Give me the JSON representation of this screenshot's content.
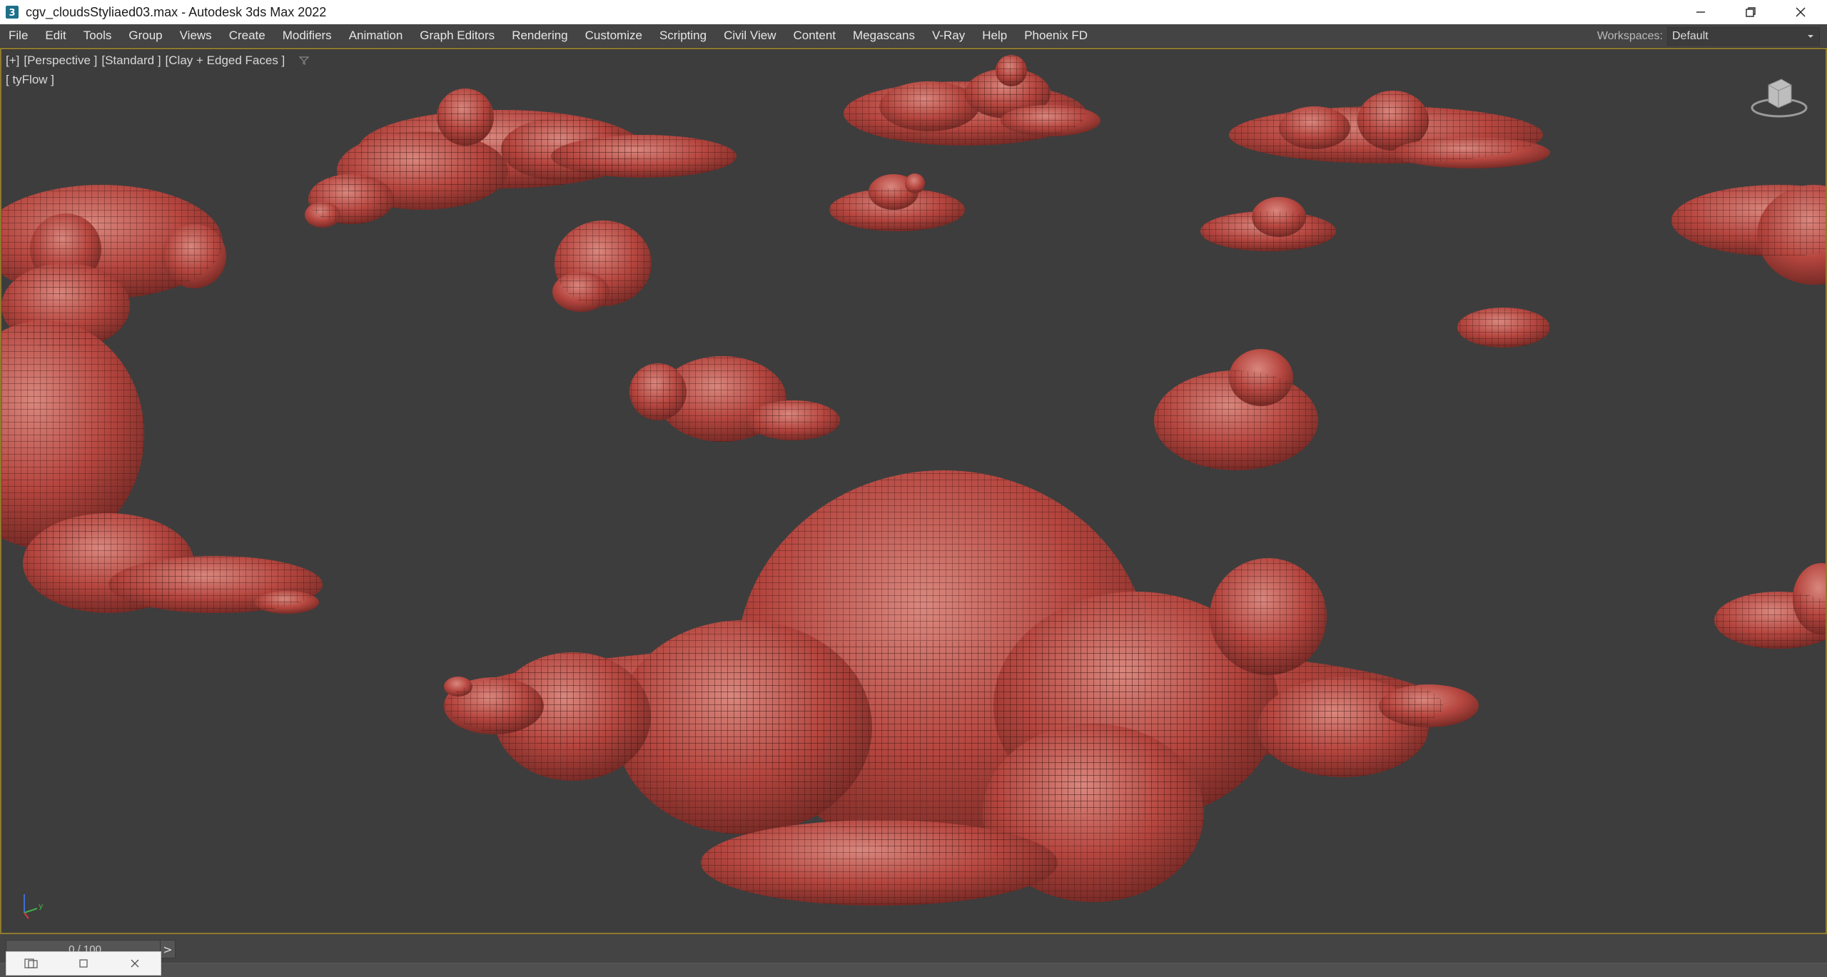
{
  "window": {
    "title": "cgv_cloudsStyliaed03.max - Autodesk 3ds Max 2022",
    "controls": [
      "minimize",
      "restore",
      "close"
    ]
  },
  "menubar": {
    "items": [
      "File",
      "Edit",
      "Tools",
      "Group",
      "Views",
      "Create",
      "Modifiers",
      "Animation",
      "Graph Editors",
      "Rendering",
      "Customize",
      "Scripting",
      "Civil View",
      "Content",
      "Megascans",
      "V-Ray",
      "Help",
      "Phoenix FD"
    ]
  },
  "workspaces": {
    "label": "Workspaces:",
    "value": "Default"
  },
  "viewport": {
    "label_plus": "[+]",
    "label_view": "[Perspective ]",
    "label_mode": "[Standard ]",
    "label_shading": "[Clay + Edged Faces ]",
    "label_plugin": "[ tyFlow ]",
    "mesh_color": "#b5463f",
    "background": "#3d3d3d",
    "axis": {
      "y": "y"
    }
  },
  "timeline": {
    "frame": "0 / 100",
    "next": ">"
  },
  "accent": "#8d7a2e"
}
